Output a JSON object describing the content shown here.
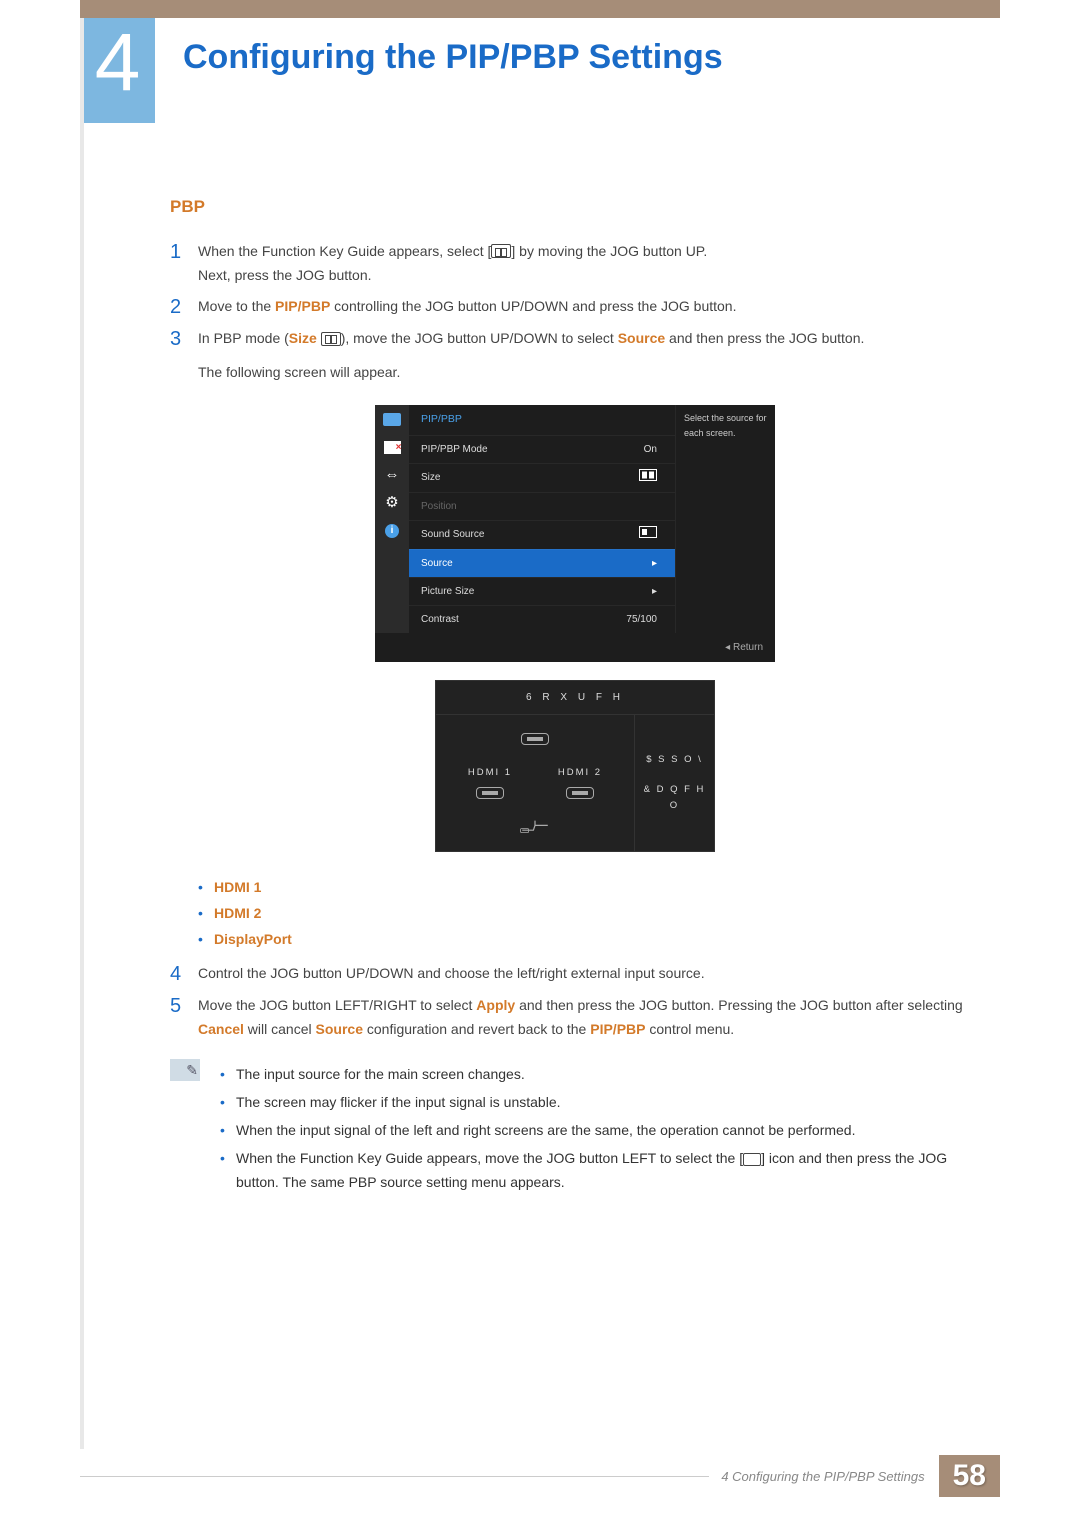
{
  "chapter_number": "4",
  "page_title": "Configuring the PIP/PBP Settings",
  "section_heading": "PBP",
  "steps": {
    "s1a": "When the Function Key Guide appears, select [",
    "s1b": "] by moving the JOG button UP.",
    "s1c": "Next, press the JOG button.",
    "s2a": "Move to the ",
    "s2_pip": "PIP/PBP",
    "s2b": " controlling the JOG button UP/DOWN and press the JOG button.",
    "s3a": "In PBP mode (",
    "s3_size": "Size",
    "s3b": "), move the JOG button UP/DOWN to select ",
    "s3_source": "Source",
    "s3c": " and then press the JOG button.",
    "s3d": "The following screen will appear.",
    "s4": "Control the JOG button UP/DOWN and choose the left/right external input source.",
    "s5a": "Move the JOG button LEFT/RIGHT to select ",
    "s5_apply": "Apply",
    "s5b": " and then press the JOG button. Pressing the JOG button after selecting ",
    "s5_cancel": "Cancel",
    "s5c": " will cancel ",
    "s5_source": "Source",
    "s5d": " configuration and revert back to the ",
    "s5_pip": "PIP/PBP",
    "s5e": " control menu."
  },
  "osd1": {
    "title": "PIP/PBP",
    "rows": {
      "mode_l": "PIP/PBP Mode",
      "mode_v": "On",
      "size_l": "Size",
      "pos_l": "Position",
      "sound_l": "Sound Source",
      "source_l": "Source",
      "picsize_l": "Picture Size",
      "contrast_l": "Contrast",
      "contrast_v": "75/100"
    },
    "help": "Select the source for each screen.",
    "return": "Return"
  },
  "osd2": {
    "title": "6 R X U F H",
    "hdmi1": "HDMI 1",
    "hdmi2": "HDMI 2",
    "apply": "$ S S O \\",
    "cancel": "& D Q F H O"
  },
  "bullets": {
    "b1": "HDMI 1",
    "b2": "HDMI 2",
    "b3": "DisplayPort"
  },
  "notes": {
    "n1": "The input source for the main screen changes.",
    "n2": "The screen may flicker if the input signal is unstable.",
    "n3": "When the input signal of the left and right screens are the same, the operation cannot be performed.",
    "n4a": "When the Function Key Guide appears, move the JOG button LEFT to select the [",
    "n4b": "] icon and then press the JOG button. The same PBP source setting menu appears."
  },
  "footer_chapter": "4 Configuring the PIP/PBP Settings",
  "page_number": "58"
}
